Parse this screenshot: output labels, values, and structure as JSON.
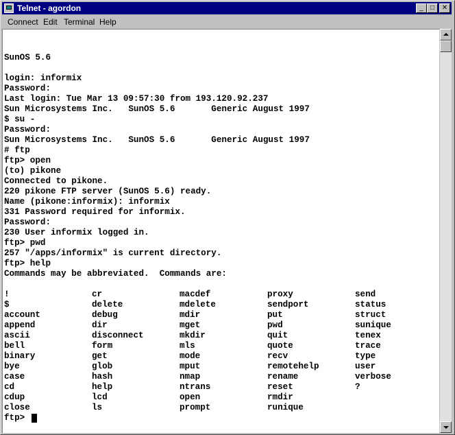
{
  "window": {
    "title": "Telnet - agordon",
    "controls": {
      "minimize": "_",
      "maximize": "□",
      "close": "✕"
    }
  },
  "menu": [
    "Connect",
    "Edit",
    "Terminal",
    "Help"
  ],
  "terminal": {
    "lines": [
      "",
      "",
      "SunOS 5.6",
      "",
      "login: informix",
      "Password:",
      "Last login: Tue Mar 13 09:57:30 from 193.120.92.237",
      "Sun Microsystems Inc.   SunOS 5.6       Generic August 1997",
      "$ su -",
      "Password:",
      "Sun Microsystems Inc.   SunOS 5.6       Generic August 1997",
      "# ftp",
      "ftp> open",
      "(to) pikone",
      "Connected to pikone.",
      "220 pikone FTP server (SunOS 5.6) ready.",
      "Name (pikone:informix): informix",
      "331 Password required for informix.",
      "Password:",
      "230 User informix logged in.",
      "ftp> pwd",
      "257 \"/apps/informix\" is current directory.",
      "ftp> help",
      "Commands may be abbreviated.  Commands are:",
      ""
    ],
    "commands_table": [
      [
        "!",
        "cr",
        "macdef",
        "proxy",
        "send"
      ],
      [
        "$",
        "delete",
        "mdelete",
        "sendport",
        "status"
      ],
      [
        "account",
        "debug",
        "mdir",
        "put",
        "struct"
      ],
      [
        "append",
        "dir",
        "mget",
        "pwd",
        "sunique"
      ],
      [
        "ascii",
        "disconnect",
        "mkdir",
        "quit",
        "tenex"
      ],
      [
        "bell",
        "form",
        "mls",
        "quote",
        "trace"
      ],
      [
        "binary",
        "get",
        "mode",
        "recv",
        "type"
      ],
      [
        "bye",
        "glob",
        "mput",
        "remotehelp",
        "user"
      ],
      [
        "case",
        "hash",
        "nmap",
        "rename",
        "verbose"
      ],
      [
        "cd",
        "help",
        "ntrans",
        "reset",
        "?"
      ],
      [
        "cdup",
        "lcd",
        "open",
        "rmdir",
        ""
      ],
      [
        "close",
        "ls",
        "prompt",
        "runique",
        ""
      ]
    ],
    "prompt": "ftp> "
  }
}
